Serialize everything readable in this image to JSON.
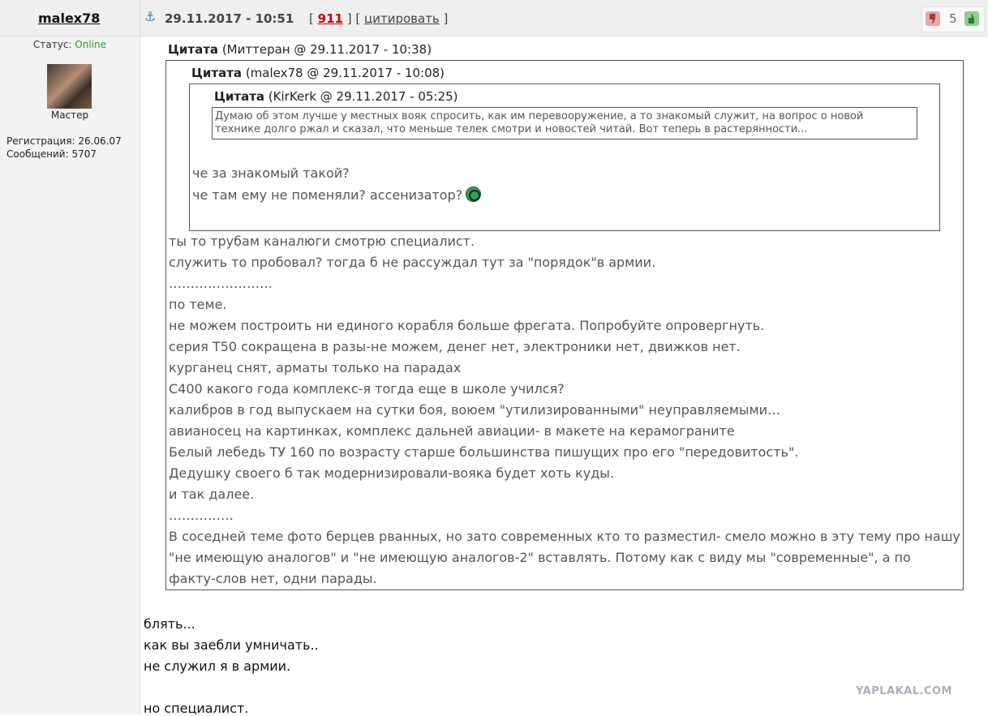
{
  "post": {
    "author": "malex78",
    "date": "29.11.2017 - 10:51",
    "number": "911",
    "quote_label": "цитировать",
    "bracket_open": "[",
    "bracket_close": "]",
    "rating": "5"
  },
  "user": {
    "status_label": "Статус: ",
    "status_value": "Online",
    "rank": "Мастер",
    "registration": "Регистрация: 26.06.07",
    "messages": "Сообщений: 5707"
  },
  "quotes": [
    {
      "label": "Цитата",
      "source": " (Миттеран @ 29.11.2017 - 10:38)"
    },
    {
      "label": "Цитата",
      "source": " (malex78 @ 29.11.2017 - 10:08)"
    },
    {
      "label": "Цитата",
      "source": " (KirKerk @ 29.11.2017 - 05:25)"
    }
  ],
  "innermost_quote_text": [
    "Думаю об этом лучше у местных вояк спросить, как им перевооружение, а то знакомый служит, на вопрос о новой",
    "технике долго ржал и сказал, что меньше телек смотри и новостей читай. Вот теперь в растерянности..."
  ],
  "middle_quote_lines": [
    "че за знакомый такой?",
    "че там ему не поменяли? ассенизатор?"
  ],
  "outer_quote_lines": [
    "ты то трубам каналюги смотрю специалист.",
    "служить то пробовал? тогда б не рассуждал тут за \"порядок\"в армии.",
    "……………………",
    "по теме.",
    "не можем построить ни единого корабля больше фрегата. Попробуйте опровергнуть.",
    "серия Т50 сокращена в разы-не можем, денег нет, электроники нет, движков нет.",
    "курганец снят, арматы только на парадах",
    "С400 какого года комплекс-я тогда еще в школе учился?",
    "калибров в год выпускаем на сутки боя, воюем \"утилизированными\" неуправляемыми…",
    "авианосец на картинках, комплекс дальней авиации- в макете на керамограните",
    "Белый лебедь ТУ 160 по возрасту старше большинства пишущих про его \"передовитость\".",
    "Дедушку своего б так модернизировали-вояка будет хоть куды.",
    "и так далее.",
    "……………",
    "В соседней теме фото берцев рванных, но зато современных кто то разместил- смело можно в эту тему про нашу",
    "\"не имеющую аналогов\" и \"не имеющую аналогов-2\" вставлять. Потому как с виду мы \"современные\", а по",
    "факту-слов нет, одни парады."
  ],
  "reply_lines": [
    "блять...",
    "как вы заебли умничать..",
    "не служил я в армии.",
    "но специалист."
  ],
  "watermark": "YAPLAKAL.COM",
  "colors": {
    "online": "#2a9d2a",
    "post_number": "#cc0000",
    "vote_down": "#e7a8a8",
    "vote_up": "#8fcf8f"
  }
}
